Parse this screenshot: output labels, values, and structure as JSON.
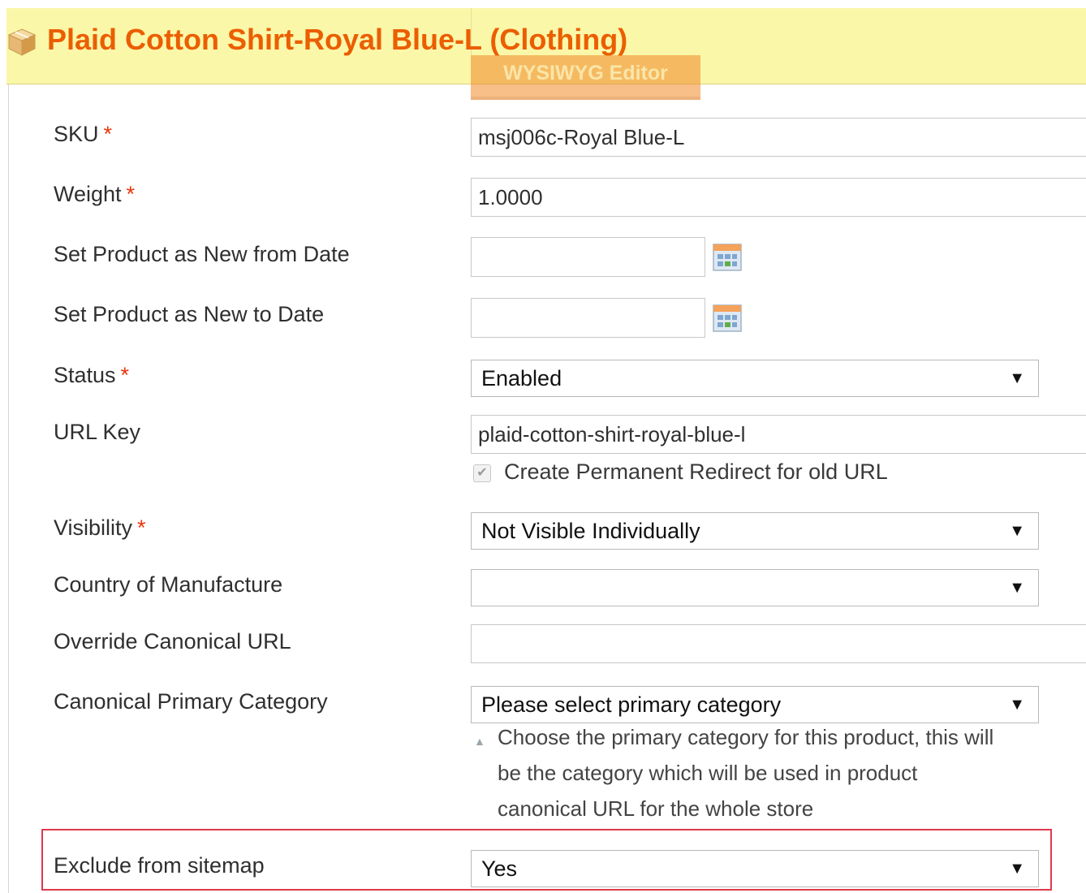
{
  "header": {
    "title": "Plaid Cotton Shirt-Royal Blue-L (Clothing)",
    "title_icon": "package-icon",
    "behind_button_label": "WYSIWYG Editor",
    "title_color": "#eb5e00",
    "header_bg": "#fbf7a9"
  },
  "form": {
    "sku": {
      "label": "SKU",
      "required": "*",
      "value": "msj006c-Royal Blue-L"
    },
    "weight": {
      "label": "Weight",
      "required": "*",
      "value": "1.0000"
    },
    "new_from": {
      "label": "Set Product as New from Date",
      "value": "",
      "icon": "calendar-icon"
    },
    "new_to": {
      "label": "Set Product as New to Date",
      "value": "",
      "icon": "calendar-icon"
    },
    "status": {
      "label": "Status",
      "required": "*",
      "selected": "Enabled"
    },
    "url_key": {
      "label": "URL Key",
      "value": "plaid-cotton-shirt-royal-blue-l",
      "redirect_label": "Create Permanent Redirect for old URL",
      "redirect_checked": true
    },
    "visibility": {
      "label": "Visibility",
      "required": "*",
      "selected": "Not Visible Individually"
    },
    "country": {
      "label": "Country of Manufacture",
      "selected": ""
    },
    "canonical_url": {
      "label": "Override Canonical URL",
      "value": ""
    },
    "primary_category": {
      "label": "Canonical Primary Category",
      "selected": "Please select primary category",
      "note_lines": [
        "Choose the primary category for this product, this will",
        "be the category which will be used in product",
        "canonical URL for the whole store"
      ]
    },
    "exclude_sitemap": {
      "label": "Exclude from sitemap",
      "selected": "Yes"
    }
  },
  "colors": {
    "required": "#eb340a",
    "highlight": "#e0394c"
  },
  "select_arrow": "▼",
  "check_mark": "✔"
}
